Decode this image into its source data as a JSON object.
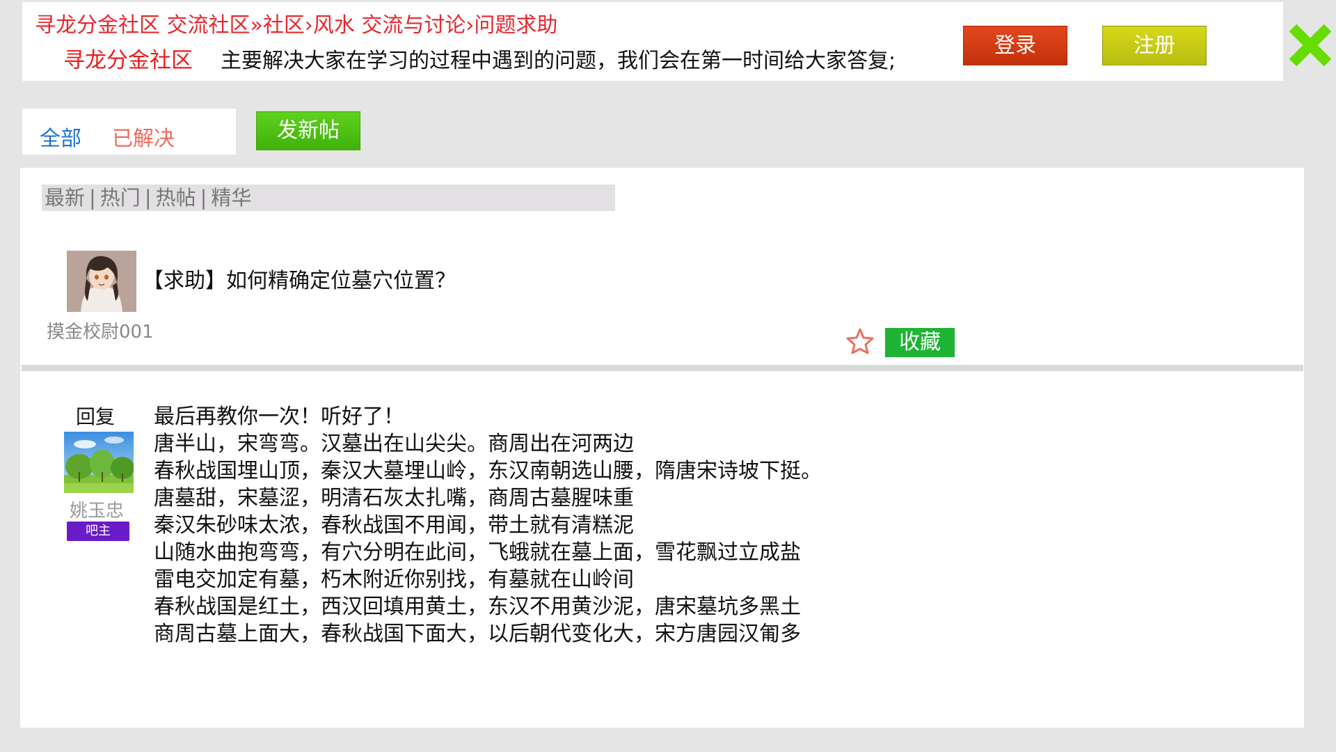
{
  "header": {
    "breadcrumb": "寻龙分金社区 交流社区»社区›风水 交流与讨论›问题求助",
    "brand": "寻龙分金社区",
    "description": "主要解决大家在学习的过程中遇到的问题，我们会在第一时间给大家答复;",
    "login_label": "登录",
    "register_label": "注册"
  },
  "filters": {
    "all_label": "全部",
    "solved_label": "已解决"
  },
  "new_post_label": "发新帖",
  "sort": {
    "items": [
      "最新",
      "热门",
      "热帖",
      "精华"
    ],
    "separator": "|"
  },
  "post": {
    "title": "【求助】如何精确定位墓穴位置？",
    "author": "摸金校尉001",
    "collect_label": "收藏"
  },
  "reply": {
    "heading": "回复",
    "author": "姚玉忠",
    "role": "吧主",
    "lines": [
      "最后再教你一次！听好了！",
      "唐半山，宋弯弯。汉墓出在山尖尖。商周出在河两边",
      "春秋战国埋山顶，秦汉大墓埋山岭，东汉南朝选山腰，隋唐宋诗坡下挺。",
      "唐墓甜，宋墓涩，明清石灰太扎嘴，商周古墓腥味重",
      "秦汉朱砂味太浓，春秋战国不用闻，带土就有清糕泥",
      "山随水曲抱弯弯，有穴分明在此间，飞蛾就在墓上面，雪花飘过立成盐",
      "雷电交加定有墓，朽木附近你别找，有墓就在山岭间",
      "春秋战国是红土，西汉回填用黄土，东汉不用黄沙泥，唐宋墓坑多黑土",
      "商周古墓上面大，春秋战国下面大，以后朝代变化大，宋方唐园汉匍多"
    ]
  },
  "colors": {
    "accent_red": "#e8262e",
    "login_bg": "#d03a12",
    "register_bg": "#c8cb14",
    "new_post_bg": "#4cc012",
    "collect_bg": "#1fb334",
    "role_badge_bg": "#6a1bc9",
    "close_icon": "#66dd00",
    "link_blue": "#1c72d8"
  },
  "icons": {
    "close": "close-icon",
    "star": "star-icon"
  }
}
